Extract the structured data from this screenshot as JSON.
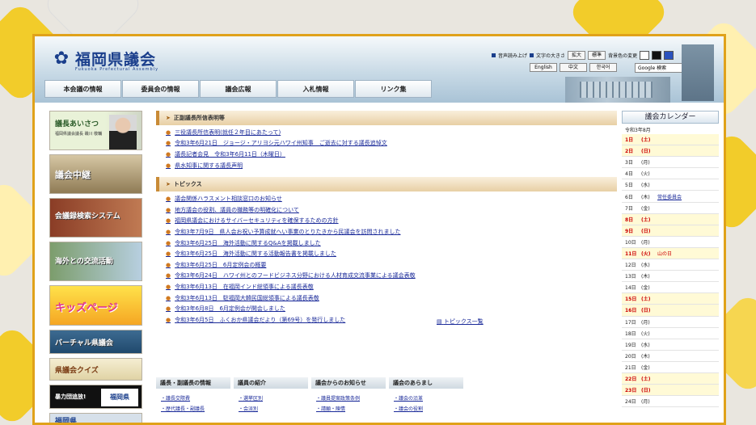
{
  "header": {
    "logo_mark": "✿",
    "title": "福岡県議会",
    "subtitle": "Fukuoka Prefectural Assembly",
    "nav": [
      "本会議の情報",
      "委員会の情報",
      "議会広報",
      "入札情報",
      "リンク集"
    ],
    "util": {
      "read_aloud": "音声読み上げ",
      "font_size": "文字の大きさ",
      "enlarge": "拡大",
      "standard": "標準",
      "bg_color": "背景色の変更",
      "white": "白",
      "black": "黒",
      "blue": "青"
    },
    "languages": [
      "English",
      "中文",
      "한국어"
    ],
    "search_placeholder": "Google 検索",
    "search_button": "検索"
  },
  "sidebar": {
    "banners": [
      {
        "label": "議長あいさつ",
        "sub": "福岡県議会議長 磯川 敬輔"
      },
      {
        "label": "議会中継"
      },
      {
        "label": "会議録検索システム"
      },
      {
        "label": "海外との交流活動"
      },
      {
        "label": "キッズページ"
      },
      {
        "label": "バーチャル県議会"
      },
      {
        "label": "県議会クイズ"
      },
      {
        "label": "暴力団追放!",
        "badge": "福岡県"
      },
      {
        "label": "福岡県"
      }
    ]
  },
  "main": {
    "section1": {
      "title": "正副議長所信表明等",
      "items": [
        "三役議長所信表明(就任２年目にあたって)",
        "令和3年6月21日　ジョージ・アリヨシ元ハワイ州知事　ご逝去に対する議長追悼文",
        "議長記者会見　令和3年6月11日（木曜日）",
        "県水知事に関する議長声明"
      ]
    },
    "section2": {
      "title": "トピックス",
      "items": [
        "議会関係ハラスメント相談窓口のお知らせ",
        "地方議会の役割、議員の職務等の明確化について",
        "福岡県議会におけるサイバーセキュリティを確保するための方針",
        "令和3年7月9日　県人会お祝い予算成就へい事業のとりたきから民議会を訪問されました",
        "令和3年6月25日　海外活動に関するQ&Aを掲載しました",
        "令和3年6月25日　海外活動に関する活動報告書を掲載しました",
        "令和3年6月25日　6月定例会の概要",
        "令和3年6月24日　ハワイ州とのフードビジネス分野における人材育成交流事業による議会表敬",
        "令和3年6月13日　在福岡インド総領事による議長表敬",
        "令和3年6月13日　駐福岡大韓民国総領事による議長表敬",
        "令和3年6月8日　6月定例会が開会しました",
        "令和3年6月5日　ふくおか県議会だより（第69号）を発行しました"
      ],
      "more": "トピックス一覧"
    },
    "categories": [
      {
        "title": "議長・副議長の情報",
        "links": [
          "議長交際費",
          "歴代議長・副議長"
        ]
      },
      {
        "title": "議員の紹介",
        "links": [
          "選挙区別",
          "会派別"
        ]
      },
      {
        "title": "議会からのお知らせ",
        "links": [
          "議員提案政策条例",
          "請願・陳情"
        ]
      },
      {
        "title": "議会のあらまし",
        "links": [
          "議会の沿革",
          "議会の役割"
        ]
      }
    ]
  },
  "calendar": {
    "title": "議会カレンダー",
    "month": "令和3年8月",
    "rows": [
      {
        "d": "1日",
        "w": "(土)",
        "e": "",
        "hol": true
      },
      {
        "d": "2日",
        "w": "(日)",
        "e": "",
        "hol": true
      },
      {
        "d": "3日",
        "w": "(月)",
        "e": "",
        "hol": false
      },
      {
        "d": "4日",
        "w": "(火)",
        "e": "",
        "hol": false
      },
      {
        "d": "5日",
        "w": "(水)",
        "e": "",
        "hol": false
      },
      {
        "d": "6日",
        "w": "(木)",
        "e": "常任委員会",
        "hol": false
      },
      {
        "d": "7日",
        "w": "(金)",
        "e": "",
        "hol": false
      },
      {
        "d": "8日",
        "w": "(土)",
        "e": "",
        "hol": true
      },
      {
        "d": "9日",
        "w": "(日)",
        "e": "",
        "hol": true
      },
      {
        "d": "10日",
        "w": "(月)",
        "e": "",
        "hol": false
      },
      {
        "d": "11日",
        "w": "(火)",
        "e": "山の日",
        "hol": true
      },
      {
        "d": "12日",
        "w": "(水)",
        "e": "",
        "hol": false
      },
      {
        "d": "13日",
        "w": "(木)",
        "e": "",
        "hol": false
      },
      {
        "d": "14日",
        "w": "(金)",
        "e": "",
        "hol": false
      },
      {
        "d": "15日",
        "w": "(土)",
        "e": "",
        "hol": true
      },
      {
        "d": "16日",
        "w": "(日)",
        "e": "",
        "hol": true
      },
      {
        "d": "17日",
        "w": "(月)",
        "e": "",
        "hol": false
      },
      {
        "d": "18日",
        "w": "(火)",
        "e": "",
        "hol": false
      },
      {
        "d": "19日",
        "w": "(水)",
        "e": "",
        "hol": false
      },
      {
        "d": "20日",
        "w": "(木)",
        "e": "",
        "hol": false
      },
      {
        "d": "21日",
        "w": "(金)",
        "e": "",
        "hol": false
      },
      {
        "d": "22日",
        "w": "(土)",
        "e": "",
        "hol": true
      },
      {
        "d": "23日",
        "w": "(日)",
        "e": "",
        "hol": true
      },
      {
        "d": "24日",
        "w": "(月)",
        "e": "",
        "hol": false
      }
    ]
  },
  "colors": {
    "frame": "#e0a21a",
    "link": "#1a2a99",
    "brand": "#1b3f8c",
    "holiday": "#cc0000"
  }
}
